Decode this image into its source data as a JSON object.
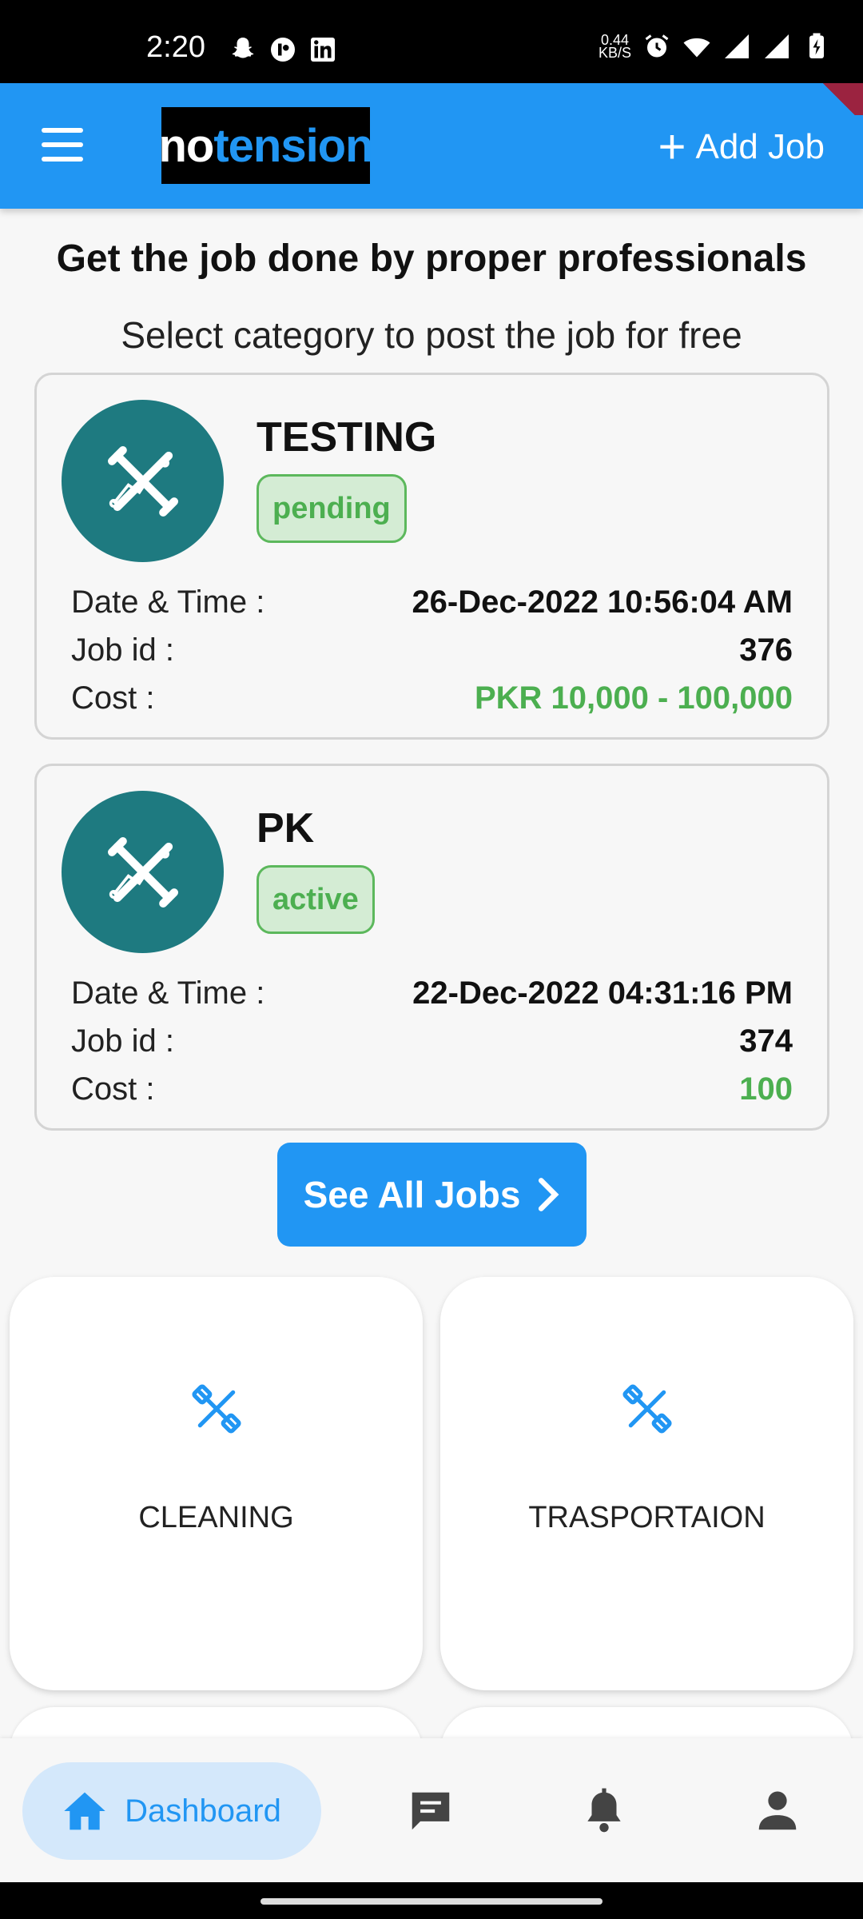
{
  "status_bar": {
    "time": "2:20",
    "net_speed": "0.44",
    "net_unit": "KB/S"
  },
  "app_bar": {
    "logo_part1": "no",
    "logo_part2": "tension",
    "add_job_label": "Add Job"
  },
  "headline": "Get the job done by proper professionals",
  "subheadline": "Select category to post the job for free",
  "jobs": [
    {
      "title": "TESTING",
      "status": "pending",
      "datetime_label": "Date & Time :",
      "datetime": "26-Dec-2022  10:56:04 AM",
      "jobid_label": "Job id :",
      "jobid": "376",
      "cost_label": "Cost :",
      "cost": "PKR 10,000 - 100,000"
    },
    {
      "title": "PK",
      "status": "active",
      "datetime_label": "Date & Time :",
      "datetime": "22-Dec-2022  04:31:16 PM",
      "jobid_label": "Job id :",
      "jobid": "374",
      "cost_label": "Cost :",
      "cost": "100"
    }
  ],
  "see_all_label": "See All Jobs",
  "categories": [
    {
      "label": "CLEANING",
      "icon": "tools-icon"
    },
    {
      "label": "TRASPORTAION",
      "icon": "tools-icon"
    }
  ],
  "bottom_nav": {
    "dashboard_label": "Dashboard",
    "items": [
      "home-icon",
      "chat-icon",
      "bell-icon",
      "person-icon"
    ]
  },
  "colors": {
    "primary": "#2196f3",
    "teal": "#1e7a80",
    "green": "#4caf50"
  }
}
